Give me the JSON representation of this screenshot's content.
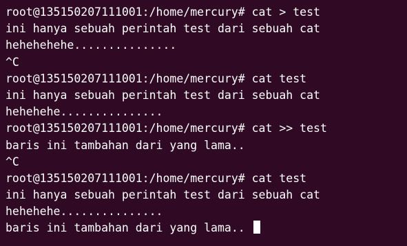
{
  "terminal": {
    "background": "#300a24",
    "foreground": "#ffffff",
    "lines": [
      "root@135150207111001:/home/mercury# cat > test",
      "ini hanya sebuah perintah test dari sebuah cat",
      "hehehehehe...............",
      "^C",
      "root@135150207111001:/home/mercury# cat test",
      "ini hanya sebuah perintah test dari sebuah cat",
      "hehehehe...............",
      "root@135150207111001:/home/mercury# cat >> test",
      "baris ini tambahan dari yang lama..",
      "^C",
      "root@135150207111001:/home/mercury# cat test",
      "ini hanya sebuah perintah test dari sebuah cat",
      "hehehehe...............",
      "baris ini tambahan dari yang lama.."
    ]
  }
}
